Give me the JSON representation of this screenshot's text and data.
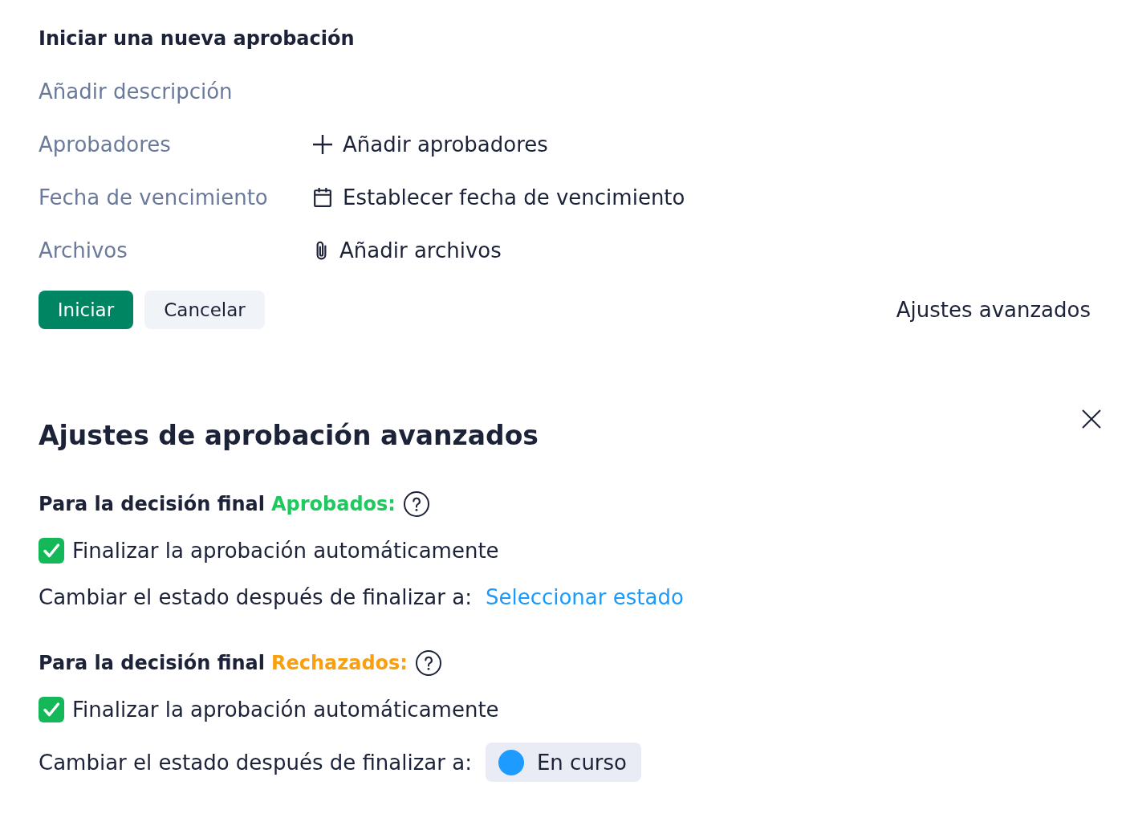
{
  "new_approval": {
    "title": "Iniciar una nueva aprobación",
    "description": {
      "placeholder": "Añadir descripción"
    },
    "fields": [
      {
        "label": "Aprobadores",
        "action": "Añadir aprobadores",
        "kind": "add"
      },
      {
        "label": "Fecha de vencimiento",
        "action": "Establecer fecha de vencimiento",
        "kind": "date"
      },
      {
        "label": "Archivos",
        "action": "Añadir archivos",
        "kind": "attach"
      }
    ],
    "buttons": [
      {
        "label": "Iniciar",
        "kind": "primary"
      },
      {
        "label": "Cancelar",
        "kind": "secondary"
      }
    ],
    "advanced_link": "Ajustes avanzados"
  },
  "advanced_settings": {
    "title": "Ajustes de aprobación avanzados",
    "groups": [
      {
        "heading": "Para la decisión final",
        "decision": "Aprobados:",
        "color": "#1ec95e",
        "auto_finalize": {
          "label": "Finalizar la aprobación automáticamente",
          "checked": true
        },
        "status_label": "Cambiar el estado después de finalizar a:",
        "status": {
          "kind": "link",
          "text": "Seleccionar estado"
        }
      },
      {
        "heading": "Para la decisión final",
        "decision": "Rechazados:",
        "color": "#f9a00e",
        "auto_finalize": {
          "label": "Finalizar la aprobación automáticamente",
          "checked": true
        },
        "status_label": "Cambiar el estado después de finalizar a:",
        "status": {
          "kind": "chip",
          "text": "En curso",
          "color": "#1e9bff"
        }
      }
    ]
  }
}
